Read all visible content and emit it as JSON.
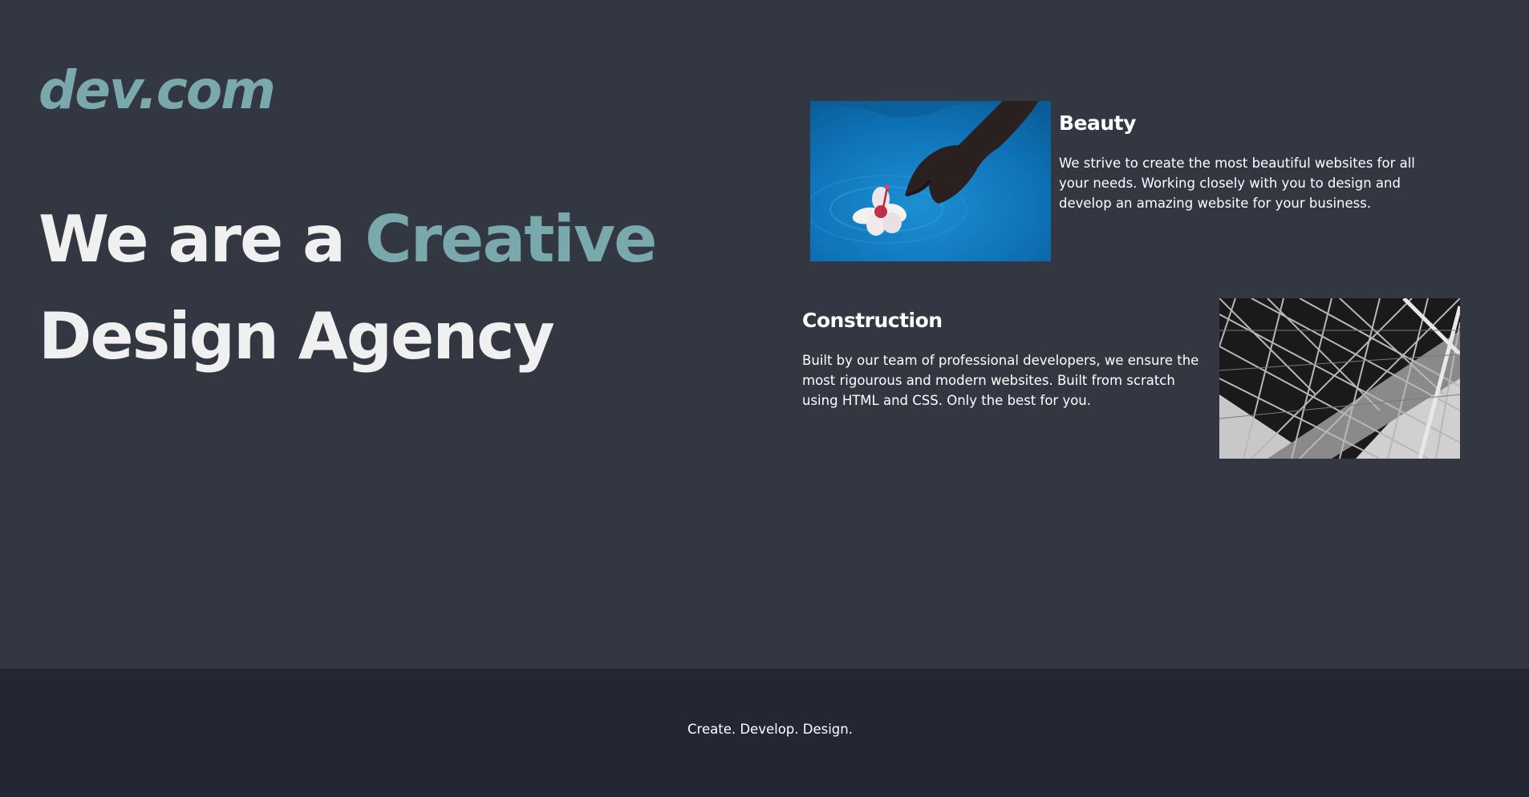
{
  "brand": {
    "logo": "dev.com",
    "accent_color": "#7aa9ad"
  },
  "hero": {
    "line1_prefix": "We are a ",
    "line1_accent": "Creative",
    "line2": "Design Agency"
  },
  "cards": [
    {
      "title": "Beauty",
      "text": "We strive to create the most beautiful websites for all your needs. Working closely with you to design and develop an amazing website for your business.",
      "image": "hand-flower-water-photo"
    },
    {
      "title": "Construction",
      "text": "Built by our team of professional developers, we ensure the most rigourous and modern websites. Built from scratch using HTML and CSS. Only the best for you.",
      "image": "steel-structure-photo"
    }
  ],
  "footer": {
    "tagline": "Create. Develop. Design."
  },
  "colors": {
    "background": "#333741",
    "footer_background": "#222733",
    "heading": "#f0f0f0"
  }
}
